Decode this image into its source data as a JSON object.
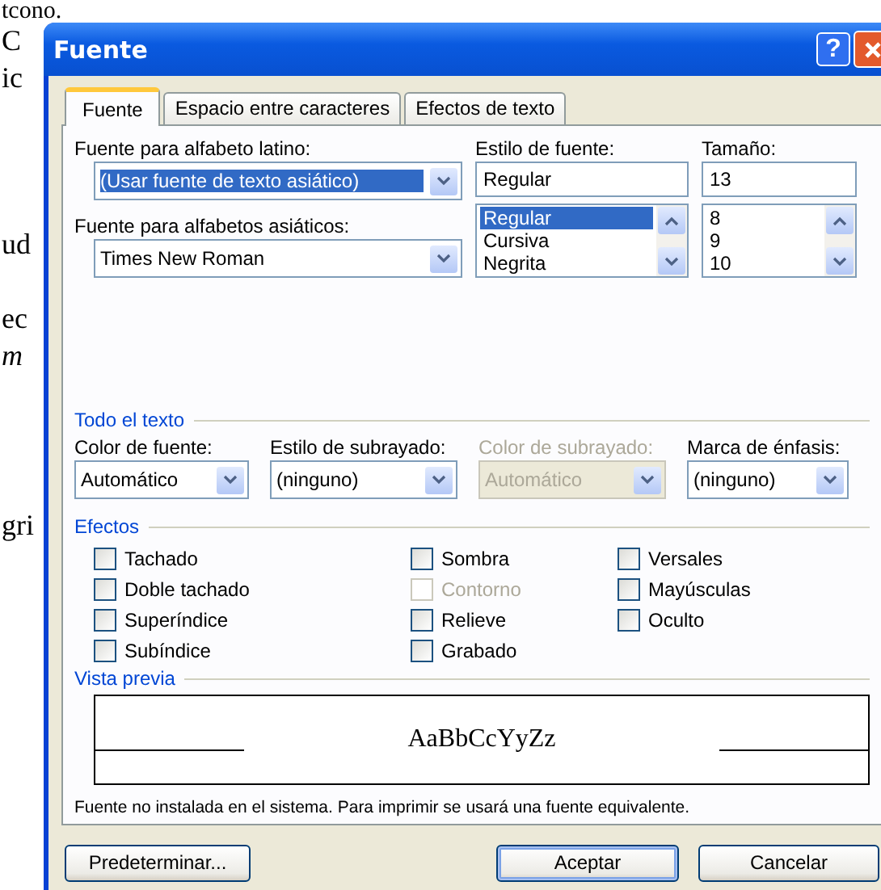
{
  "document_lines": [
    {
      "text": "tcono.",
      "italic": false
    },
    {
      "text": "C",
      "italic": false
    },
    {
      "text": "ic",
      "italic": false
    },
    {
      "text": "ud",
      "italic": false
    },
    {
      "text": "ec",
      "italic": false
    },
    {
      "text": "m",
      "italic": true
    },
    {
      "text": "gri",
      "italic": false
    }
  ],
  "window": {
    "title": "Fuente",
    "help": "?"
  },
  "tabs": [
    {
      "label": "Fuente",
      "selected": true
    },
    {
      "label": "Espacio entre caracteres",
      "selected": false
    },
    {
      "label": "Efectos de texto",
      "selected": false
    }
  ],
  "latin_font": {
    "label": "Fuente para alfabeto latino:",
    "value": "(Usar fuente de texto asiático)",
    "highlighted": true
  },
  "asian_font": {
    "label": "Fuente para alfabetos asiáticos:",
    "value": "Times New Roman",
    "highlighted": false
  },
  "font_style": {
    "label": "Estilo de fuente:",
    "value": "Regular",
    "options": [
      {
        "label": "Regular",
        "selected": true
      },
      {
        "label": "Cursiva",
        "selected": false
      },
      {
        "label": "Negrita",
        "selected": false
      }
    ]
  },
  "size": {
    "label": "Tamaño:",
    "value": "13",
    "options": [
      {
        "label": "8",
        "selected": false
      },
      {
        "label": "9",
        "selected": false
      },
      {
        "label": "10",
        "selected": false
      }
    ]
  },
  "all_text": {
    "heading": "Todo el texto",
    "fields": [
      {
        "label": "Color de fuente:",
        "value": "Automático",
        "disabled": false
      },
      {
        "label": "Estilo de subrayado:",
        "value": "(ninguno)",
        "disabled": false
      },
      {
        "label": "Color de subrayado:",
        "value": "Automático",
        "disabled": true
      },
      {
        "label": "Marca de énfasis:",
        "value": "(ninguno)",
        "disabled": false
      }
    ]
  },
  "effects": {
    "heading": "Efectos",
    "columns": [
      [
        {
          "label": "Tachado",
          "checked": false,
          "disabled": false
        },
        {
          "label": "Doble tachado",
          "checked": false,
          "disabled": false
        },
        {
          "label": "Superíndice",
          "checked": false,
          "disabled": false
        },
        {
          "label": "Subíndice",
          "checked": false,
          "disabled": false
        }
      ],
      [
        {
          "label": "Sombra",
          "checked": false,
          "disabled": false
        },
        {
          "label": "Contorno",
          "checked": false,
          "disabled": true
        },
        {
          "label": "Relieve",
          "checked": false,
          "disabled": false
        },
        {
          "label": "Grabado",
          "checked": false,
          "disabled": false
        }
      ],
      [
        {
          "label": "Versales",
          "checked": false,
          "disabled": false
        },
        {
          "label": "Mayúsculas",
          "checked": false,
          "disabled": false
        },
        {
          "label": "Oculto",
          "checked": false,
          "disabled": false
        }
      ]
    ]
  },
  "preview": {
    "heading": "Vista previa",
    "sample": "AaBbCcYyZz",
    "note": "Fuente no instalada en el sistema. Para imprimir se usará una fuente equivalente."
  },
  "buttons": [
    {
      "label": "Predeterminar...",
      "default": false
    },
    {
      "label": "Aceptar",
      "default": true
    },
    {
      "label": "Cancelar",
      "default": false
    }
  ]
}
